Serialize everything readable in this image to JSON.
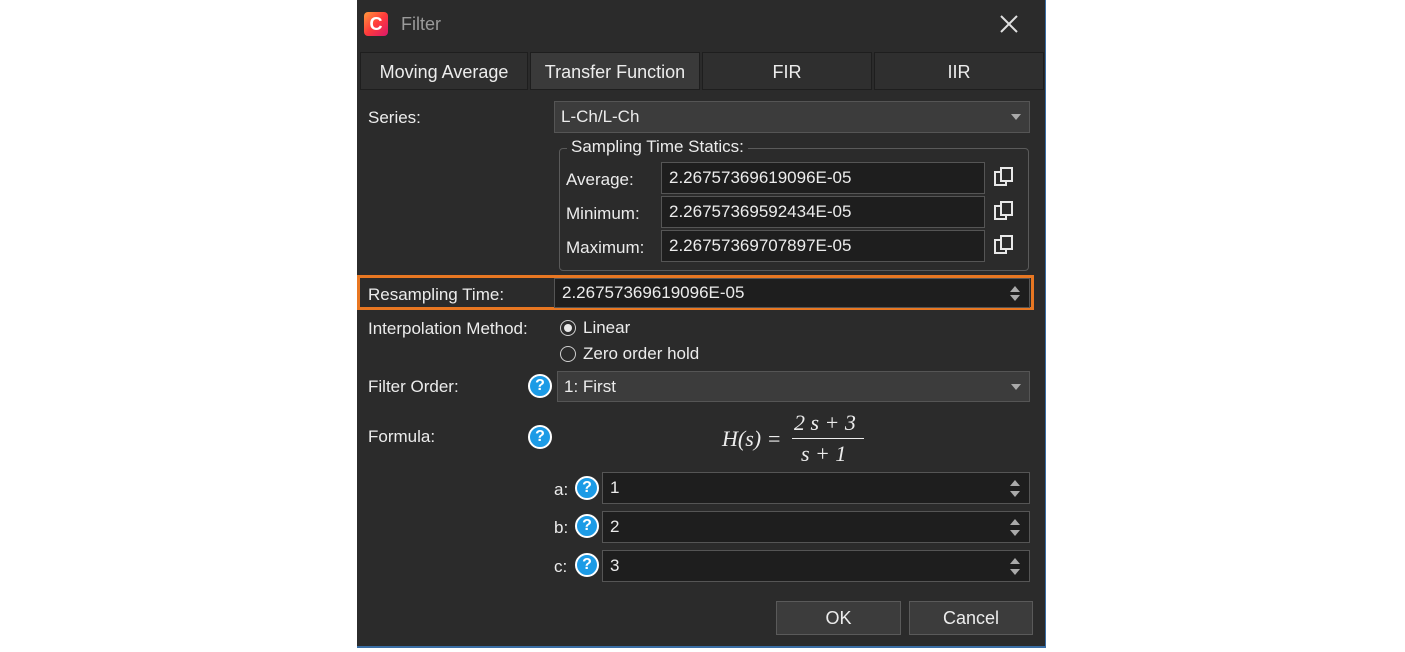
{
  "window": {
    "title": "Filter",
    "app_icon_letter": "C"
  },
  "tabs": [
    {
      "label": "Moving Average"
    },
    {
      "label": "Transfer Function"
    },
    {
      "label": "FIR"
    },
    {
      "label": "IIR"
    }
  ],
  "series": {
    "label": "Series:",
    "value": "L-Ch/L-Ch"
  },
  "sampling": {
    "title": "Sampling Time Statics:",
    "average_label": "Average:",
    "average_value": "2.26757369619096E-05",
    "minimum_label": "Minimum:",
    "minimum_value": "2.26757369592434E-05",
    "maximum_label": "Maximum:",
    "maximum_value": "2.26757369707897E-05"
  },
  "resampling": {
    "label": "Resampling Time:",
    "value": "2.26757369619096E-05"
  },
  "interpolation": {
    "label": "Interpolation Method:",
    "option1": "Linear",
    "option2": "Zero order hold",
    "selected": "Linear"
  },
  "filter_order": {
    "label": "Filter Order:",
    "value": "1: First"
  },
  "formula": {
    "label": "Formula:",
    "lhs": "H(s) =",
    "numerator": "2 s + 3",
    "denominator": "s + 1"
  },
  "params": {
    "a_label": "a:",
    "a_value": "1",
    "b_label": "b:",
    "b_value": "2",
    "c_label": "c:",
    "c_value": "3"
  },
  "buttons": {
    "ok": "OK",
    "cancel": "Cancel"
  },
  "colors": {
    "background": "#2b2b2b",
    "highlight": "#e87722",
    "help": "#1c9be6"
  }
}
